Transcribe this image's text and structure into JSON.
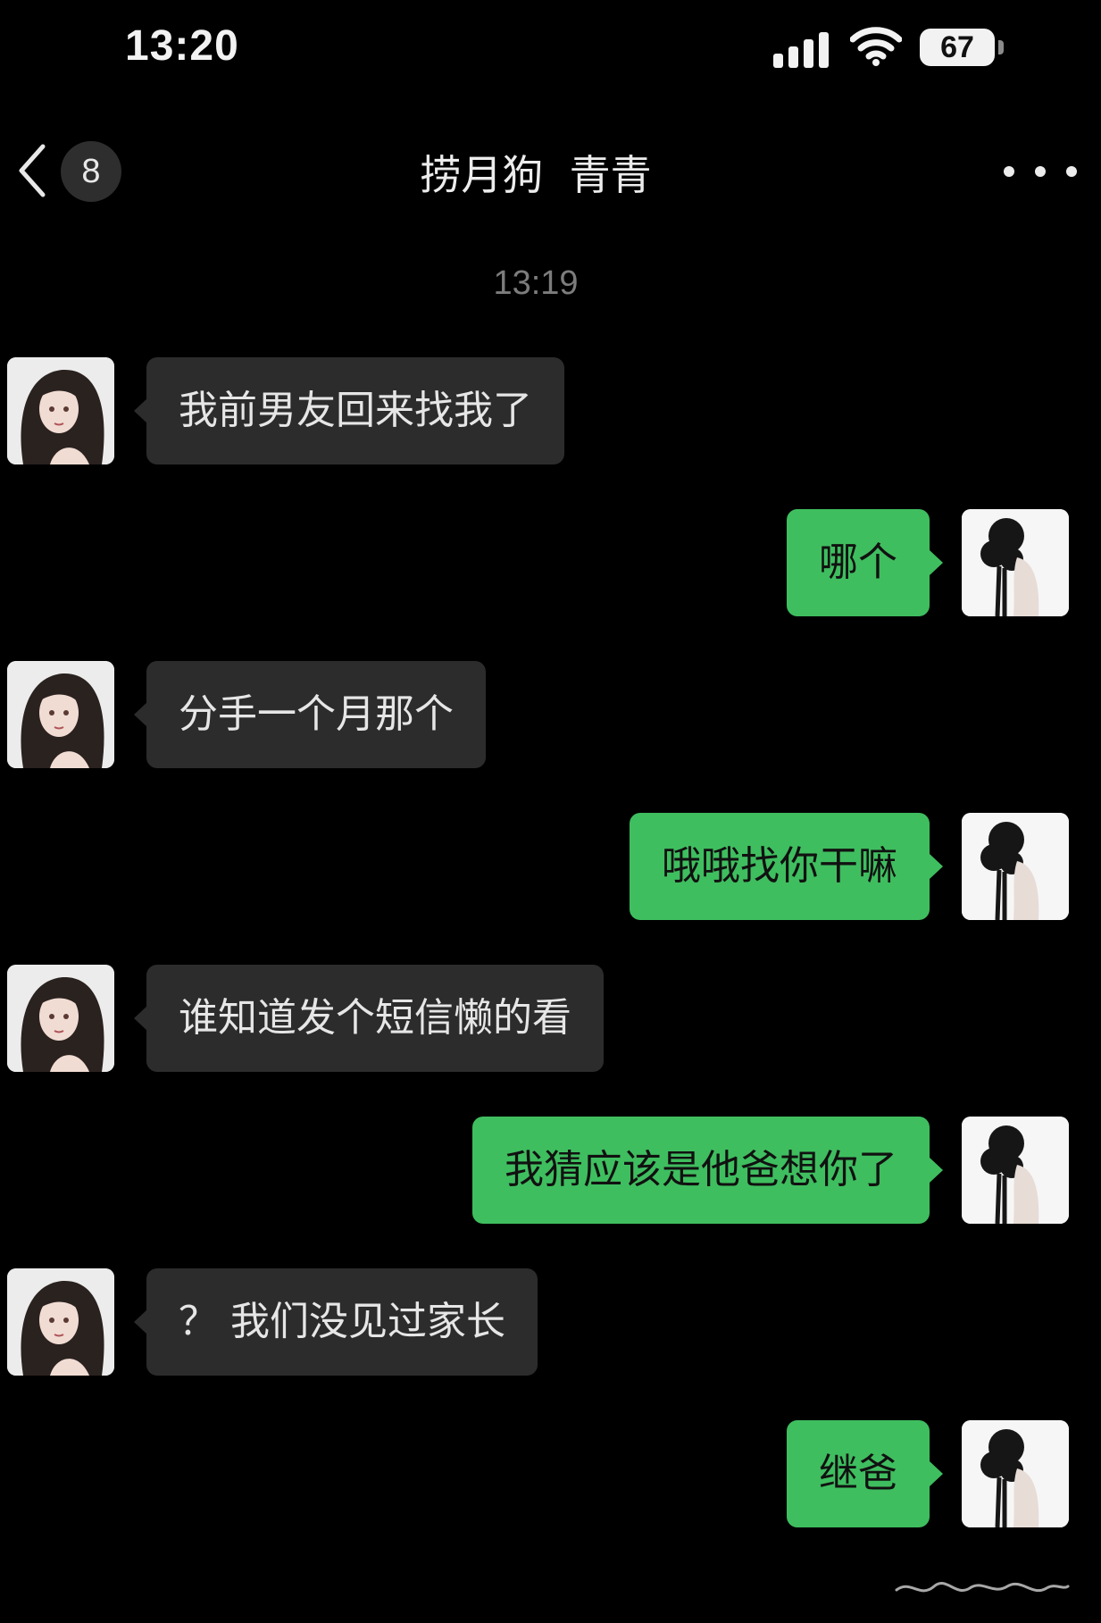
{
  "status_bar": {
    "time": "13:20",
    "battery": "67",
    "signal_icon": "cellular-signal-icon",
    "wifi_icon": "wifi-icon"
  },
  "nav": {
    "back_icon": "chevron-left-icon",
    "unread_count": "8",
    "title": "捞月狗  青青",
    "more_icon": "more-dots-icon"
  },
  "chat": {
    "timestamp": "13:19",
    "messages": [
      {
        "side": "left",
        "text": "我前男友回来找我了"
      },
      {
        "side": "right",
        "text": "哪个"
      },
      {
        "side": "left",
        "text": "分手一个月那个"
      },
      {
        "side": "right",
        "text": "哦哦找你干嘛"
      },
      {
        "side": "left",
        "text": "谁知道发个短信懒的看"
      },
      {
        "side": "right",
        "text": "我猜应该是他爸想你了"
      },
      {
        "side": "left",
        "text": "？ 我们没见过家长"
      },
      {
        "side": "right",
        "text": "继爸"
      }
    ]
  },
  "colors": {
    "background": "#000000",
    "incoming_bubble": "#2c2c2c",
    "outgoing_bubble": "#3fbe5f",
    "timestamp_text": "#7c7c7c"
  }
}
